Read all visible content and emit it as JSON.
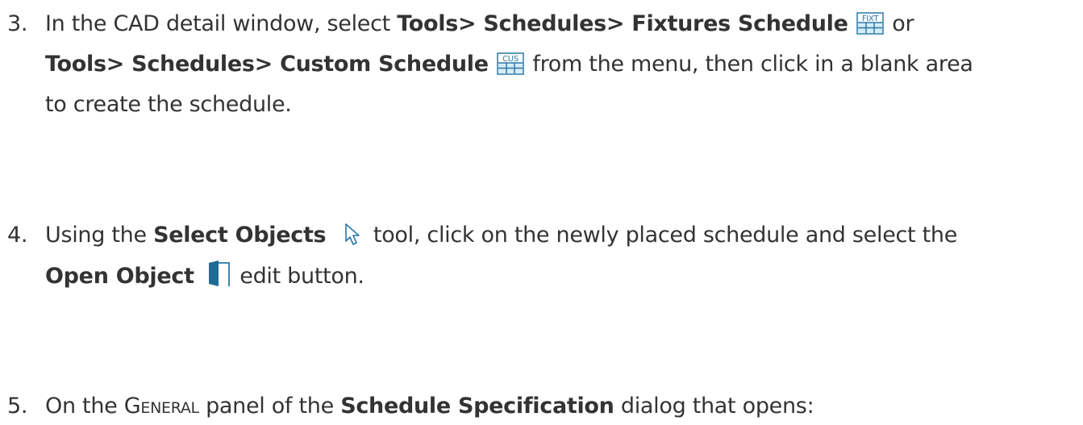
{
  "steps": [
    {
      "number": "3.",
      "lines": [
        {
          "t1": "In the CAD detail window, select ",
          "b1": "Tools> Schedules> Fixtures Schedule",
          "icon_text": "FIXT",
          "t2": " or"
        },
        {
          "b1": "Tools> Schedules> Custom Schedule",
          "icon_text": "CUS",
          "t2": " from the menu, then click in a blank area"
        },
        {
          "t1": "to create the schedule."
        }
      ]
    },
    {
      "number": "4.",
      "lines": [
        {
          "t1": "Using the ",
          "b1": "Select Objects",
          "t2": " tool, click on the newly placed schedule and select the"
        },
        {
          "b1": "Open Object",
          "t2": " edit button."
        }
      ]
    },
    {
      "number": "5.",
      "lines": [
        {
          "t1": "On the ",
          "sc": "General",
          "t2": " panel of the ",
          "b1": "Schedule Specification",
          "t3": " dialog that opens:"
        }
      ]
    }
  ],
  "icons": {
    "fixtures_schedule": "fixtures-schedule-icon",
    "custom_schedule": "custom-schedule-icon",
    "select_objects": "select-arrow-icon",
    "open_object": "open-door-icon"
  },
  "colors": {
    "text": "#333333",
    "icon_blue": "#2b78a8",
    "icon_fill": "#d6ecf7"
  }
}
